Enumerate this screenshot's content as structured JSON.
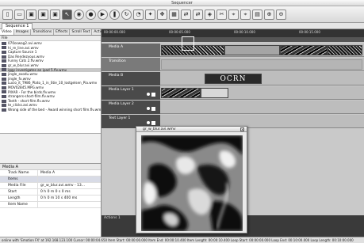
{
  "window": {
    "title": "Sequencer"
  },
  "toolbar": {
    "buttons": [
      {
        "icon": "new-document-icon",
        "glyph": "▯"
      },
      {
        "icon": "open-folder-icon",
        "glyph": "▭"
      },
      {
        "icon": "monitor-icon",
        "glyph": "▣"
      },
      {
        "icon": "monitor-icon",
        "glyph": "▣"
      },
      {
        "icon": "monitor-icon",
        "glyph": "▣"
      },
      {
        "icon": "cursor-icon",
        "glyph": "↖"
      },
      {
        "icon": "stop-icon",
        "glyph": "◉"
      },
      {
        "icon": "record-icon",
        "glyph": "●"
      },
      {
        "icon": "play-icon",
        "glyph": "▶"
      },
      {
        "icon": "pause-icon",
        "glyph": "❚"
      },
      {
        "icon": "refresh-icon",
        "glyph": "↻"
      },
      {
        "icon": "palette-icon",
        "glyph": "◔"
      },
      {
        "icon": "effect-icon",
        "glyph": "✦"
      },
      {
        "icon": "move-icon",
        "glyph": "✥"
      },
      {
        "icon": "grid-icon",
        "glyph": "▦"
      },
      {
        "icon": "link-icon",
        "glyph": "⇄"
      },
      {
        "icon": "link-icon",
        "glyph": "⇄"
      },
      {
        "icon": "snap-icon",
        "glyph": "◈"
      },
      {
        "icon": "cut-icon",
        "glyph": "✂"
      },
      {
        "icon": "marker-icon",
        "glyph": "⌖"
      },
      {
        "icon": "marker-icon",
        "glyph": "⌖"
      },
      {
        "icon": "chart-icon",
        "glyph": "▤"
      },
      {
        "icon": "zoom-icon",
        "glyph": "⊕"
      },
      {
        "icon": "zoom-out-icon",
        "glyph": "⊖"
      }
    ]
  },
  "sequence_tab": "Sequence 1",
  "left_tabs": [
    "Video",
    "Images",
    "Transitions",
    "Effects",
    "Scroll Text",
    "Actions"
  ],
  "file_header": "File",
  "files": [
    "070oswag2.avi.wmv",
    "hi_re_line.avi.wmv",
    "Capture Source 1",
    "Das Rendezvous.wmv",
    "Funny Cats 2.flv.wmv",
    "gr_w_blur.avi.wmv",
    "iggy investigates an ipad 5.flv.wmv",
    "jingle_exodu.wmv",
    "jingle_fx.wmv",
    "Lucio_it_T986_Plato_1_in_Stie_10_lostgelsen_Pia.wmv",
    "MOV02845.MPG.wmv",
    "PIXAR - For the birds.flv.wmv",
    "strangers-short-film.flv.wmv",
    "Teeth - short film.flv.wmv",
    "te_clicks.avi.wmv",
    "Wrong side of the bed - Award winning short film.flv.wmv"
  ],
  "selected_file_index": 6,
  "properties": {
    "header": "Media A",
    "track_name_label": "Track Name",
    "track_name_value": "Media A",
    "group_label": "Items",
    "rows": [
      {
        "key": "Media File",
        "value": "gr_w_blur.avi.wmv - 13..."
      },
      {
        "key": "Start",
        "value": "0 h 0 m 0 s 0 ms"
      },
      {
        "key": "Length",
        "value": "0 h 0 m 10 s 400 ms"
      },
      {
        "key": "Item Name",
        "value": ""
      }
    ]
  },
  "ruler_ticks": [
    "00:00:00.000",
    "00:00:05.000",
    "00:00:10.000",
    "00:00:15.000"
  ],
  "tracks": [
    {
      "name": "Media A"
    },
    {
      "name": "Transition"
    },
    {
      "name": "Media B"
    },
    {
      "name": "Media Layer 1"
    },
    {
      "name": "Media Layer 2"
    },
    {
      "name": "Text Layer 1"
    }
  ],
  "preview": {
    "title": "gr_w_blur.avi.wmv"
  },
  "media_b_overlay_text": "OCRN",
  "actions_label": "Actions 1",
  "status": "online with 'Emotion FX' at 192.168.123.100   Cursor: 00:00:04.650   Item Start: 00:00:00.000   Item End: 00:00:10.400   Item Length: 00:00:10.400   Loop Start: 00:00:00.000   Loop End: 00:10:00.000   Loop Length: 00:10:00.000"
}
